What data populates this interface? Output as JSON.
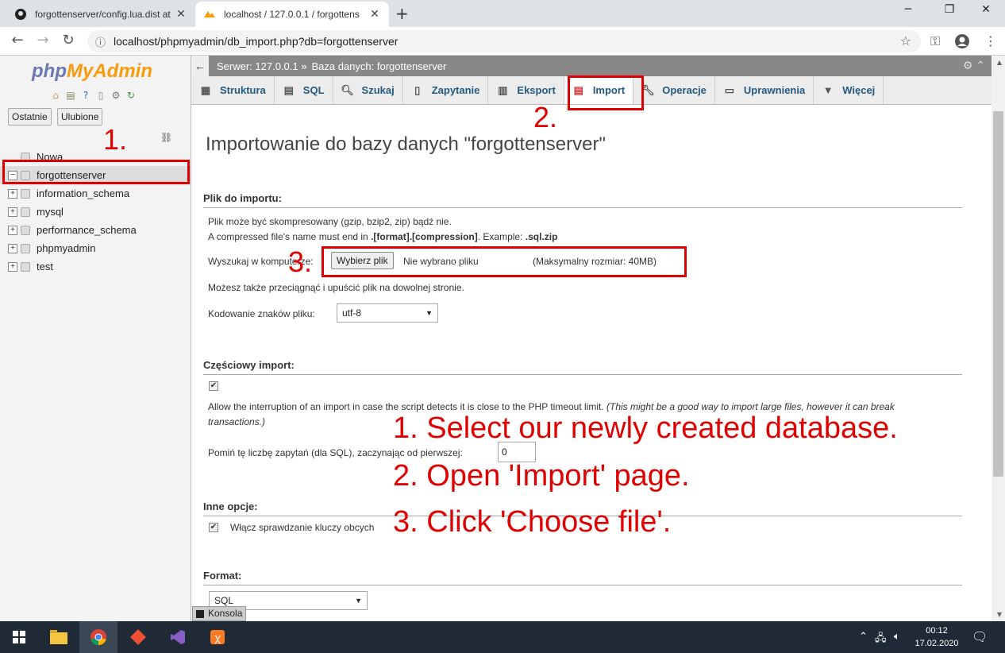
{
  "browser": {
    "tabs": [
      {
        "title": "forgottenserver/config.lua.dist at"
      },
      {
        "title": "localhost / 127.0.0.1 / forgottens"
      }
    ],
    "new_tab": "+",
    "url": "localhost/phpmyadmin/db_import.php?db=forgottenserver"
  },
  "sidebar": {
    "logo_php": "php",
    "logo_myadmin": "MyAdmin",
    "btn_recent": "Ostatnie",
    "btn_favorites": "Ulubione",
    "databases": [
      {
        "name": "Nowa"
      },
      {
        "name": "forgottenserver"
      },
      {
        "name": "information_schema"
      },
      {
        "name": "mysql"
      },
      {
        "name": "performance_schema"
      },
      {
        "name": "phpmyadmin"
      },
      {
        "name": "test"
      }
    ]
  },
  "breadcrumb": {
    "server": "Serwer: 127.0.0.1 »",
    "database": "Baza danych: forgottenserver"
  },
  "tabs": [
    {
      "label": "Struktura"
    },
    {
      "label": "SQL"
    },
    {
      "label": "Szukaj"
    },
    {
      "label": "Zapytanie"
    },
    {
      "label": "Eksport"
    },
    {
      "label": "Import"
    },
    {
      "label": "Operacje"
    },
    {
      "label": "Uprawnienia"
    },
    {
      "label": "Więcej"
    }
  ],
  "page": {
    "title": "Importowanie do bazy danych \"forgottenserver\"",
    "file_section": {
      "legend": "Plik do importu:",
      "note1": "Plik może być skompresowany (gzip, bzip2, zip) bądź nie.",
      "note2_pre": "A compressed file's name must end in ",
      "note2_format": ".[format].[compression]",
      "note2_mid": ". Example: ",
      "note2_example": ".sql.zip",
      "browse_label": "Wyszukaj w komputerze:",
      "choose_button": "Wybierz plik",
      "no_file": "Nie wybrano pliku",
      "max_size": "(Maksymalny rozmiar: 40MB)",
      "drag_note": "Możesz także przeciągnąć i upuścić plik na dowolnej stronie.",
      "charset_label": "Kodowanie znaków pliku:",
      "charset_value": "utf-8"
    },
    "partial_section": {
      "legend": "Częściowy import:",
      "allow_text": "Allow the interruption of an import in case the script detects it is close to the PHP timeout limit.",
      "allow_note": "(This might be a good way to import large files, however it can break",
      "allow_note2": "transactions.)",
      "skip_label": "Pomiń tę liczbę zapytań (dla SQL), zaczynając od pierwszej:",
      "skip_value": "0"
    },
    "other_section": {
      "legend": "Inne opcje:",
      "fk_label": "Włącz sprawdzanie kluczy obcych"
    },
    "format_section": {
      "legend": "Format:",
      "format_value": "SQL"
    }
  },
  "console_label": "Konsola",
  "annotations": {
    "num1": "1.",
    "num2": "2.",
    "num3": "3.",
    "step1": "1. Select our newly created database.",
    "step2": "2. Open 'Import' page.",
    "step3": "3. Click 'Choose file'."
  },
  "clock": {
    "time": "00:12",
    "date": "17.02.2020"
  },
  "colors": {
    "annotation": "#e00000",
    "link": "#235a81",
    "logo_php": "#6c78af",
    "logo_myadmin": "#f89c0e"
  }
}
